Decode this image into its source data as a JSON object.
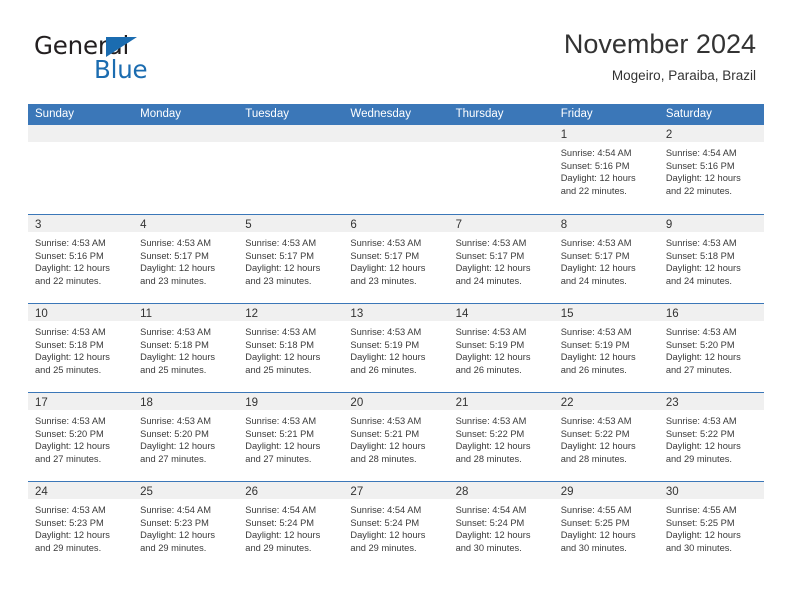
{
  "brand": {
    "name_part1": "General",
    "name_part2": "Blue",
    "triangle_color": "#1b6cb0"
  },
  "header": {
    "title": "November 2024",
    "subtitle": "Mogeiro, Paraiba, Brazil"
  },
  "theme": {
    "header_blue": "#3b77b8",
    "daynum_band": "#f0f0f0",
    "text": "#333333"
  },
  "weekdays": [
    "Sunday",
    "Monday",
    "Tuesday",
    "Wednesday",
    "Thursday",
    "Friday",
    "Saturday"
  ],
  "weeks": [
    [
      {
        "day": "",
        "sunrise": "",
        "sunset": "",
        "daylight_l1": "",
        "daylight_l2": ""
      },
      {
        "day": "",
        "sunrise": "",
        "sunset": "",
        "daylight_l1": "",
        "daylight_l2": ""
      },
      {
        "day": "",
        "sunrise": "",
        "sunset": "",
        "daylight_l1": "",
        "daylight_l2": ""
      },
      {
        "day": "",
        "sunrise": "",
        "sunset": "",
        "daylight_l1": "",
        "daylight_l2": ""
      },
      {
        "day": "",
        "sunrise": "",
        "sunset": "",
        "daylight_l1": "",
        "daylight_l2": ""
      },
      {
        "day": "1",
        "sunrise": "Sunrise: 4:54 AM",
        "sunset": "Sunset: 5:16 PM",
        "daylight_l1": "Daylight: 12 hours",
        "daylight_l2": "and 22 minutes."
      },
      {
        "day": "2",
        "sunrise": "Sunrise: 4:54 AM",
        "sunset": "Sunset: 5:16 PM",
        "daylight_l1": "Daylight: 12 hours",
        "daylight_l2": "and 22 minutes."
      }
    ],
    [
      {
        "day": "3",
        "sunrise": "Sunrise: 4:53 AM",
        "sunset": "Sunset: 5:16 PM",
        "daylight_l1": "Daylight: 12 hours",
        "daylight_l2": "and 22 minutes."
      },
      {
        "day": "4",
        "sunrise": "Sunrise: 4:53 AM",
        "sunset": "Sunset: 5:17 PM",
        "daylight_l1": "Daylight: 12 hours",
        "daylight_l2": "and 23 minutes."
      },
      {
        "day": "5",
        "sunrise": "Sunrise: 4:53 AM",
        "sunset": "Sunset: 5:17 PM",
        "daylight_l1": "Daylight: 12 hours",
        "daylight_l2": "and 23 minutes."
      },
      {
        "day": "6",
        "sunrise": "Sunrise: 4:53 AM",
        "sunset": "Sunset: 5:17 PM",
        "daylight_l1": "Daylight: 12 hours",
        "daylight_l2": "and 23 minutes."
      },
      {
        "day": "7",
        "sunrise": "Sunrise: 4:53 AM",
        "sunset": "Sunset: 5:17 PM",
        "daylight_l1": "Daylight: 12 hours",
        "daylight_l2": "and 24 minutes."
      },
      {
        "day": "8",
        "sunrise": "Sunrise: 4:53 AM",
        "sunset": "Sunset: 5:17 PM",
        "daylight_l1": "Daylight: 12 hours",
        "daylight_l2": "and 24 minutes."
      },
      {
        "day": "9",
        "sunrise": "Sunrise: 4:53 AM",
        "sunset": "Sunset: 5:18 PM",
        "daylight_l1": "Daylight: 12 hours",
        "daylight_l2": "and 24 minutes."
      }
    ],
    [
      {
        "day": "10",
        "sunrise": "Sunrise: 4:53 AM",
        "sunset": "Sunset: 5:18 PM",
        "daylight_l1": "Daylight: 12 hours",
        "daylight_l2": "and 25 minutes."
      },
      {
        "day": "11",
        "sunrise": "Sunrise: 4:53 AM",
        "sunset": "Sunset: 5:18 PM",
        "daylight_l1": "Daylight: 12 hours",
        "daylight_l2": "and 25 minutes."
      },
      {
        "day": "12",
        "sunrise": "Sunrise: 4:53 AM",
        "sunset": "Sunset: 5:18 PM",
        "daylight_l1": "Daylight: 12 hours",
        "daylight_l2": "and 25 minutes."
      },
      {
        "day": "13",
        "sunrise": "Sunrise: 4:53 AM",
        "sunset": "Sunset: 5:19 PM",
        "daylight_l1": "Daylight: 12 hours",
        "daylight_l2": "and 26 minutes."
      },
      {
        "day": "14",
        "sunrise": "Sunrise: 4:53 AM",
        "sunset": "Sunset: 5:19 PM",
        "daylight_l1": "Daylight: 12 hours",
        "daylight_l2": "and 26 minutes."
      },
      {
        "day": "15",
        "sunrise": "Sunrise: 4:53 AM",
        "sunset": "Sunset: 5:19 PM",
        "daylight_l1": "Daylight: 12 hours",
        "daylight_l2": "and 26 minutes."
      },
      {
        "day": "16",
        "sunrise": "Sunrise: 4:53 AM",
        "sunset": "Sunset: 5:20 PM",
        "daylight_l1": "Daylight: 12 hours",
        "daylight_l2": "and 27 minutes."
      }
    ],
    [
      {
        "day": "17",
        "sunrise": "Sunrise: 4:53 AM",
        "sunset": "Sunset: 5:20 PM",
        "daylight_l1": "Daylight: 12 hours",
        "daylight_l2": "and 27 minutes."
      },
      {
        "day": "18",
        "sunrise": "Sunrise: 4:53 AM",
        "sunset": "Sunset: 5:20 PM",
        "daylight_l1": "Daylight: 12 hours",
        "daylight_l2": "and 27 minutes."
      },
      {
        "day": "19",
        "sunrise": "Sunrise: 4:53 AM",
        "sunset": "Sunset: 5:21 PM",
        "daylight_l1": "Daylight: 12 hours",
        "daylight_l2": "and 27 minutes."
      },
      {
        "day": "20",
        "sunrise": "Sunrise: 4:53 AM",
        "sunset": "Sunset: 5:21 PM",
        "daylight_l1": "Daylight: 12 hours",
        "daylight_l2": "and 28 minutes."
      },
      {
        "day": "21",
        "sunrise": "Sunrise: 4:53 AM",
        "sunset": "Sunset: 5:22 PM",
        "daylight_l1": "Daylight: 12 hours",
        "daylight_l2": "and 28 minutes."
      },
      {
        "day": "22",
        "sunrise": "Sunrise: 4:53 AM",
        "sunset": "Sunset: 5:22 PM",
        "daylight_l1": "Daylight: 12 hours",
        "daylight_l2": "and 28 minutes."
      },
      {
        "day": "23",
        "sunrise": "Sunrise: 4:53 AM",
        "sunset": "Sunset: 5:22 PM",
        "daylight_l1": "Daylight: 12 hours",
        "daylight_l2": "and 29 minutes."
      }
    ],
    [
      {
        "day": "24",
        "sunrise": "Sunrise: 4:53 AM",
        "sunset": "Sunset: 5:23 PM",
        "daylight_l1": "Daylight: 12 hours",
        "daylight_l2": "and 29 minutes."
      },
      {
        "day": "25",
        "sunrise": "Sunrise: 4:54 AM",
        "sunset": "Sunset: 5:23 PM",
        "daylight_l1": "Daylight: 12 hours",
        "daylight_l2": "and 29 minutes."
      },
      {
        "day": "26",
        "sunrise": "Sunrise: 4:54 AM",
        "sunset": "Sunset: 5:24 PM",
        "daylight_l1": "Daylight: 12 hours",
        "daylight_l2": "and 29 minutes."
      },
      {
        "day": "27",
        "sunrise": "Sunrise: 4:54 AM",
        "sunset": "Sunset: 5:24 PM",
        "daylight_l1": "Daylight: 12 hours",
        "daylight_l2": "and 29 minutes."
      },
      {
        "day": "28",
        "sunrise": "Sunrise: 4:54 AM",
        "sunset": "Sunset: 5:24 PM",
        "daylight_l1": "Daylight: 12 hours",
        "daylight_l2": "and 30 minutes."
      },
      {
        "day": "29",
        "sunrise": "Sunrise: 4:55 AM",
        "sunset": "Sunset: 5:25 PM",
        "daylight_l1": "Daylight: 12 hours",
        "daylight_l2": "and 30 minutes."
      },
      {
        "day": "30",
        "sunrise": "Sunrise: 4:55 AM",
        "sunset": "Sunset: 5:25 PM",
        "daylight_l1": "Daylight: 12 hours",
        "daylight_l2": "and 30 minutes."
      }
    ]
  ]
}
